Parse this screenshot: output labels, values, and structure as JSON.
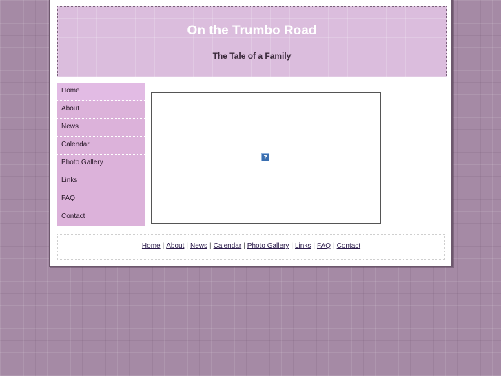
{
  "header": {
    "title": "On the Trumbo Road",
    "subtitle": "The Tale of a Family"
  },
  "nav": {
    "items": [
      {
        "label": "Home"
      },
      {
        "label": "About"
      },
      {
        "label": "News"
      },
      {
        "label": "Calendar"
      },
      {
        "label": "Photo Gallery"
      },
      {
        "label": "Links"
      },
      {
        "label": "FAQ"
      },
      {
        "label": "Contact"
      }
    ]
  },
  "content": {
    "placeholder_glyph": "?"
  },
  "footer": {
    "separator": "|",
    "links": [
      {
        "label": "Home"
      },
      {
        "label": "About"
      },
      {
        "label": "News"
      },
      {
        "label": "Calendar"
      },
      {
        "label": "Photo Gallery"
      },
      {
        "label": "Links"
      },
      {
        "label": "FAQ"
      },
      {
        "label": "Contact"
      }
    ]
  },
  "colors": {
    "page_background": "#a58aa5",
    "header_background": "#dbbddd",
    "sidebar_background": "#dcb2da",
    "title_color": "#ffffff"
  }
}
